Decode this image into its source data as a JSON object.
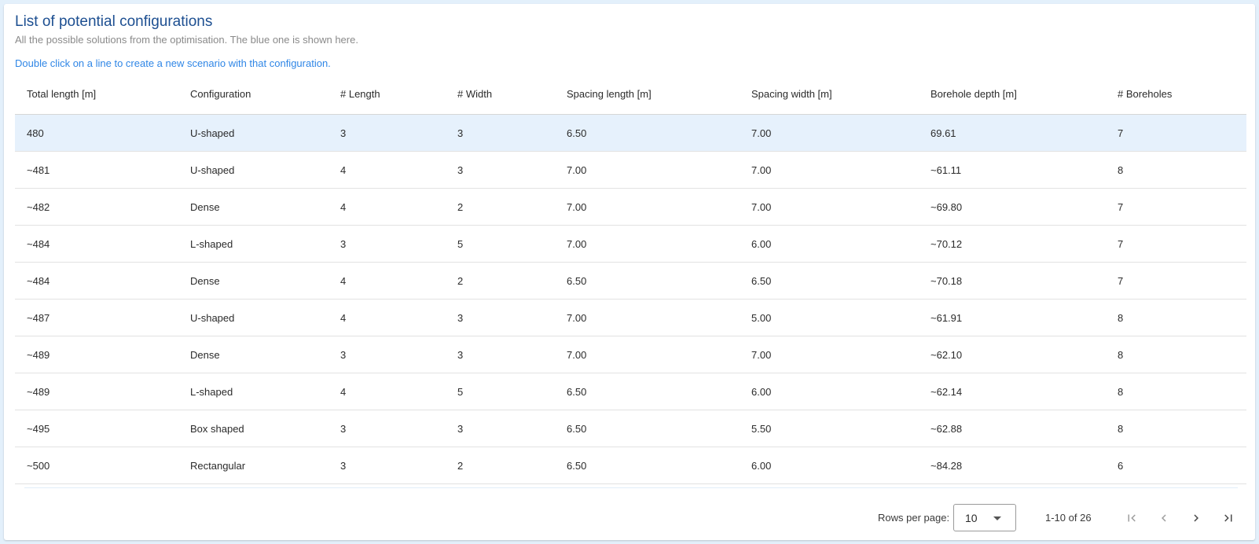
{
  "panel": {
    "title": "List of potential configurations",
    "subtitle": "All the possible solutions from the optimisation. The blue one is shown here.",
    "hint": "Double click on a line to create a new scenario with that configuration."
  },
  "table": {
    "columns": [
      "Total length [m]",
      "Configuration",
      "# Length",
      "# Width",
      "Spacing length [m]",
      "Spacing width [m]",
      "Borehole depth [m]",
      "# Boreholes"
    ],
    "selected_row": 0,
    "rows": [
      [
        "480",
        "U-shaped",
        "3",
        "3",
        "6.50",
        "7.00",
        "69.61",
        "7"
      ],
      [
        "~481",
        "U-shaped",
        "4",
        "3",
        "7.00",
        "7.00",
        "~61.11",
        "8"
      ],
      [
        "~482",
        "Dense",
        "4",
        "2",
        "7.00",
        "7.00",
        "~69.80",
        "7"
      ],
      [
        "~484",
        "L-shaped",
        "3",
        "5",
        "7.00",
        "6.00",
        "~70.12",
        "7"
      ],
      [
        "~484",
        "Dense",
        "4",
        "2",
        "6.50",
        "6.50",
        "~70.18",
        "7"
      ],
      [
        "~487",
        "U-shaped",
        "4",
        "3",
        "7.00",
        "5.00",
        "~61.91",
        "8"
      ],
      [
        "~489",
        "Dense",
        "3",
        "3",
        "7.00",
        "7.00",
        "~62.10",
        "8"
      ],
      [
        "~489",
        "L-shaped",
        "4",
        "5",
        "6.50",
        "6.00",
        "~62.14",
        "8"
      ],
      [
        "~495",
        "Box shaped",
        "3",
        "3",
        "6.50",
        "5.50",
        "~62.88",
        "8"
      ],
      [
        "~500",
        "Rectangular",
        "3",
        "2",
        "6.50",
        "6.00",
        "~84.28",
        "6"
      ]
    ]
  },
  "pagination": {
    "rows_per_page_label": "Rows per page:",
    "rows_per_page_value": "10",
    "range_text": "1-10 of 26",
    "icons": {
      "first": "first-page-icon",
      "prev": "chevron-left-icon",
      "next": "chevron-right-icon",
      "last": "last-page-icon",
      "select": "caret-down-icon"
    }
  },
  "colors": {
    "title": "#1d4f91",
    "hint": "#2f86e6",
    "selected_row_bg": "#e6f1fc",
    "page_bg": "#e3f0fb"
  }
}
